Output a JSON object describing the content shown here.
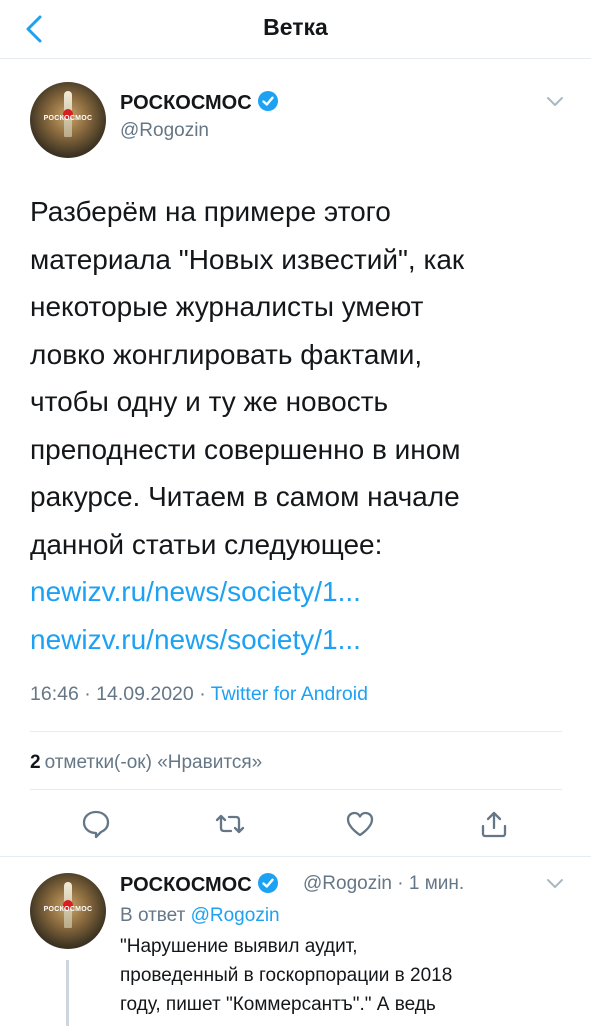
{
  "nav": {
    "title": "Ветка",
    "back_icon": "chevron-left-icon"
  },
  "tweet": {
    "author_name": "РОСКОСМОС",
    "author_handle": "@Rogozin",
    "avatar_label": "РОСКОСМОС",
    "text_lines": [
      "Разберём на примере этого",
      "материала \"Новых известий\", как",
      "некоторые журналисты умеют",
      "ловко жонглировать фактами,",
      "чтобы одну и ту же новость",
      "преподнести совершенно в ином",
      "ракурсе. Читаем в самом начале",
      "данной статьи следующее:"
    ],
    "links": [
      "newizv.ru/news/society/1...",
      "newizv.ru/news/society/1..."
    ],
    "time": "16:46",
    "date": "14.09.2020",
    "meta_dot": "·",
    "source": "Twitter for Android",
    "likes_count": "2",
    "likes_label": "отметки(-ок) «Нравится»"
  },
  "actions": [
    "reply-icon",
    "retweet-icon",
    "like-icon",
    "share-icon"
  ],
  "reply": {
    "author_name": "РОСКОСМОС",
    "handle_time": "@Rogozin · 1 мин.",
    "in_reply_prefix": "В ответ",
    "in_reply_mention": "@Rogozin",
    "avatar_label": "РОСКОСМОС",
    "text_lines": [
      "\"Нарушение выявил аудит,",
      "проведенный в госкорпорации в 2018",
      "году, пишет \"Коммерсантъ\".\" А ведь"
    ]
  },
  "colors": {
    "accent": "#1da1f2",
    "text": "#14171a",
    "muted": "#657786",
    "divider": "#e6ecf0"
  }
}
